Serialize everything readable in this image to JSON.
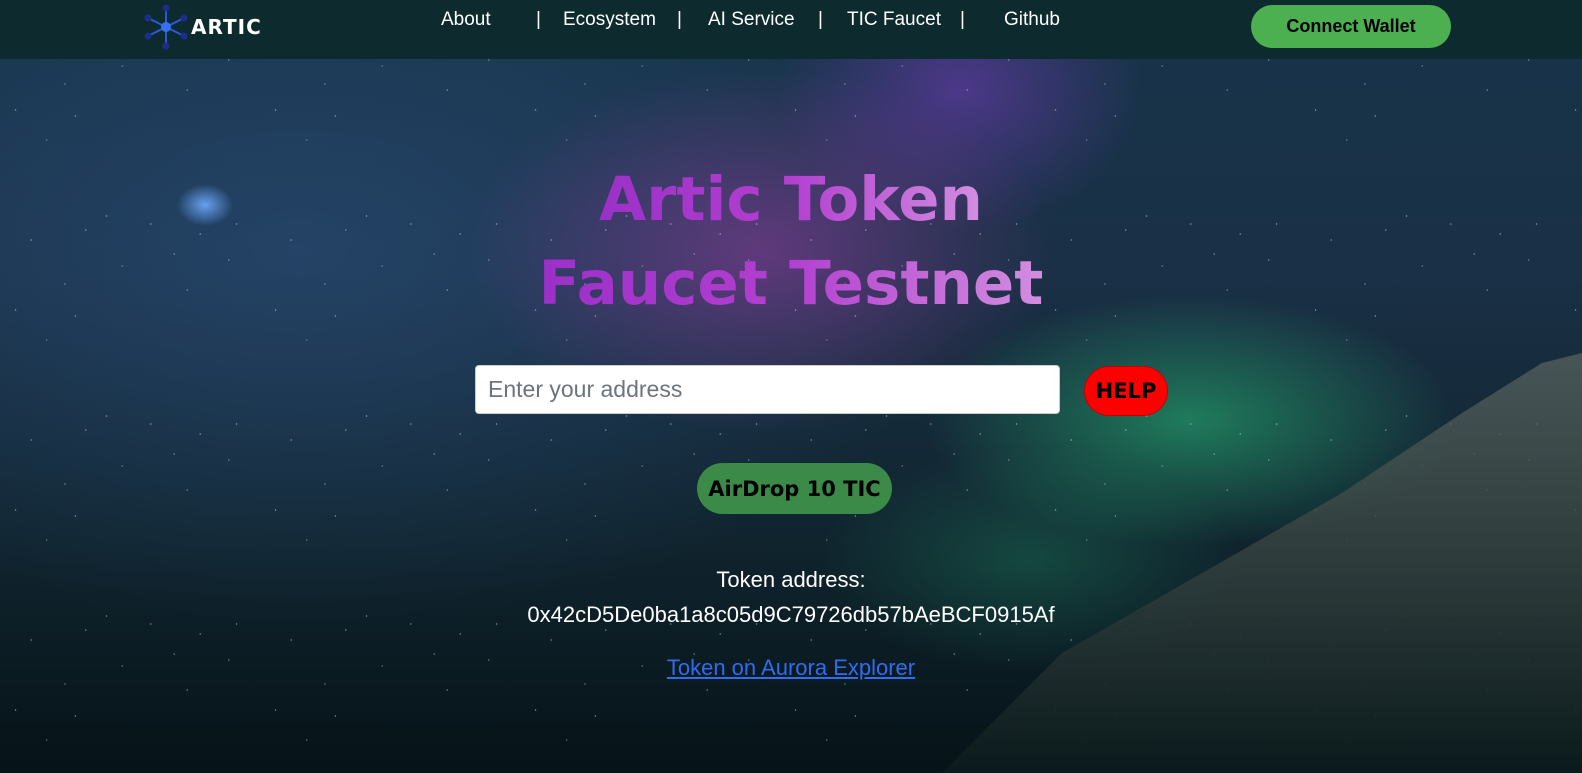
{
  "nav": {
    "logo_text": "ARTIC",
    "items": [
      {
        "label": "About"
      },
      {
        "label": "Ecosystem"
      },
      {
        "label": "AI Service"
      },
      {
        "label": "TIC Faucet"
      },
      {
        "label": "Github"
      }
    ],
    "separator": "|",
    "connect_label": "Connect Wallet"
  },
  "hero": {
    "title_line1": "Artic Token",
    "title_line2": "Faucet Testnet"
  },
  "form": {
    "address_placeholder": "Enter your address",
    "address_value": "",
    "help_label": "HELP",
    "airdrop_label": "AirDrop 10 TIC"
  },
  "token": {
    "label": "Token address:",
    "address": "0x42cD5De0ba1a8c05d9C79726db57bAeBCF0915Af",
    "explorer_link": "Token on Aurora Explorer"
  },
  "colors": {
    "navbar_bg": "#0d2a2f",
    "connect_green": "#4caf50",
    "airdrop_green": "#3c8a48",
    "help_red": "#ff0000",
    "title_purple": "#a83ccc",
    "link_blue": "#2f6df0"
  },
  "icons": {
    "logo": "network-nodes-icon"
  }
}
